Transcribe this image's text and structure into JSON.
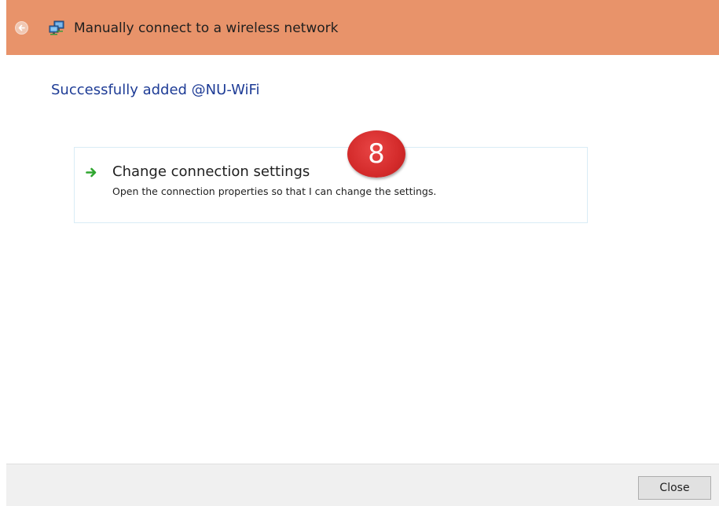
{
  "window": {
    "title": "Manually connect to a wireless network",
    "icon": "network-icon",
    "accent_color": "#e8936a"
  },
  "main": {
    "heading": "Successfully added @NU-WiFi",
    "command_link": {
      "title": "Change connection settings",
      "description": "Open the connection properties so that I can change the settings.",
      "icon": "green-arrow-icon"
    }
  },
  "annotation": {
    "step_number": "8"
  },
  "footer": {
    "close_label": "Close"
  }
}
